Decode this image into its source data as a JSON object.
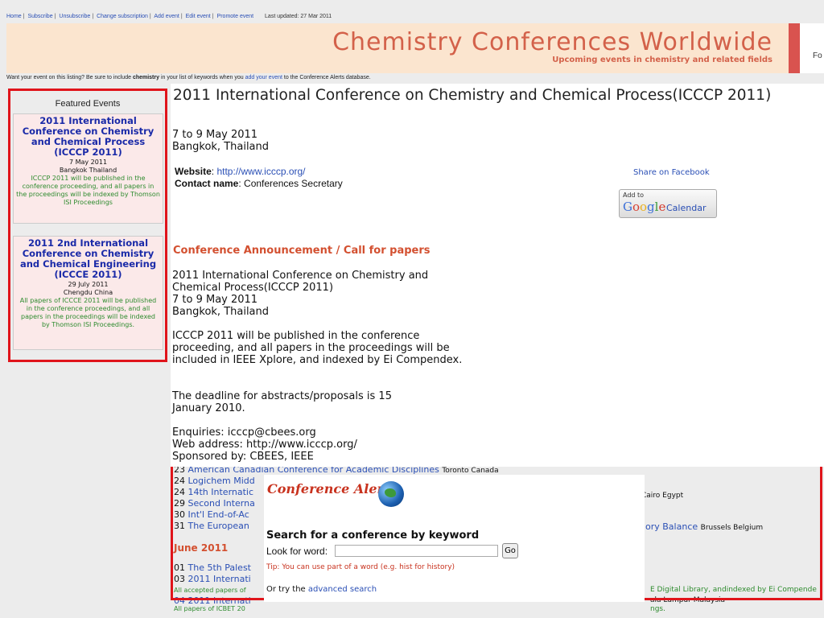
{
  "nav": {
    "links": [
      "Home",
      "Subscribe",
      "Unsubscribe",
      "Change subscription",
      "Add event",
      "Edit event",
      "Promote event"
    ],
    "last_updated": "Last updated: 27 Mar 2011"
  },
  "banner": {
    "title": "Chemistry Conferences Worldwide",
    "subtitle": "Upcoming events in chemistry and related fields",
    "right_text": "Fo"
  },
  "notice": {
    "prefix": "Want your event on this listing? Be sure to include ",
    "keyword": "chemistry",
    "middle": " in your list of keywords when you ",
    "link": "add your event",
    "suffix": " to the Conference Alerts database."
  },
  "featured": {
    "heading": "Featured Events",
    "items": [
      {
        "title": "2011 International Conference on Chemistry and Chemical Process (ICCCP 2011)",
        "date": "7 May 2011",
        "location": "Bangkok Thailand",
        "description": "ICCCP 2011 will be published in the conference proceeding, and all papers in the proceedings will be indexed by Thomson ISI Proceedings"
      },
      {
        "title": "2011 2nd International Conference on Chemistry and Chemical Engineering (ICCCE 2011)",
        "date": "29 July 2011",
        "location": "Chengdu China",
        "description": "All papers of ICCCE 2011 will be published in the conference proceedings, and all papers in the proceedings will be indexed by Thomson ISI Proceedings."
      }
    ]
  },
  "event": {
    "title": "2011 International Conference on Chemistry and Chemical Process(ICCCP 2011)",
    "dates": "7 to 9 May 2011",
    "location": "Bangkok, Thailand",
    "website_label": "Website",
    "website": "http://www.icccp.org/",
    "contact_label": "Contact name",
    "contact": "Conferences Secretary",
    "share": "Share on Facebook",
    "gcal_add": "Add to",
    "gcal_google": "Google",
    "gcal_calendar": "Calendar",
    "announce_heading": "Conference Announcement / Call for papers",
    "para1": "2011 International Conference on Chemistry and Chemical Process(ICCCP 2011)\n7 to 9 May 2011\nBangkok, Thailand",
    "para2": "ICCCP 2011 will be published in the conference proceeding, and all papers in the proceedings will be included in IEEE Xplore, and indexed by Ei Compendex.",
    "para3": "The deadline for abstracts/proposals is 15 January 2010.",
    "para4": "Enquiries: icccp@cbees.org\nWeb address: http://www.icccp.org/\nSponsored by: CBEES, IEEE"
  },
  "listing": {
    "rows": [
      {
        "num": "23",
        "title": "American Canadian Conference for Academic Disciplines",
        "loc": "Toronto Canada"
      },
      {
        "num": "24",
        "title": "Logichem Midd",
        "loc": ""
      },
      {
        "num": "24",
        "title": "14th Internatic",
        "loc": ""
      },
      {
        "num": "29",
        "title": "Second Interna",
        "loc": ""
      },
      {
        "num": "30",
        "title": "Int'l End-of-Ac",
        "loc": ""
      },
      {
        "num": "31",
        "title": "The European",
        "loc": ""
      }
    ],
    "right_cairo": "Cairo Egypt",
    "right_balance": "ory Balance",
    "right_brussels": "Brussels Belgium",
    "june": "June 2011",
    "june_rows": [
      {
        "num": "01",
        "title": "The 5th Palest"
      },
      {
        "num": "03",
        "title": "2011 Internati"
      }
    ],
    "green1": "All accepted papers of",
    "green1_right": "E Digital Library, andindexed by Ei Compende",
    "row04": "04 2011 Internati",
    "row04_right": "ala Lumpur Malaysia",
    "green2": "All papers of ICBET 20",
    "green2_right": "ngs."
  },
  "alerts": {
    "logo": "Conference Alerts",
    "search_title": "Search for a conference by keyword",
    "look_label": "Look for word:",
    "input_value": "",
    "go": "Go",
    "tip": "Tip: You can use part of a word (e.g. hist for history)",
    "ortry_prefix": "Or try the ",
    "ortry_link": "advanced search"
  }
}
